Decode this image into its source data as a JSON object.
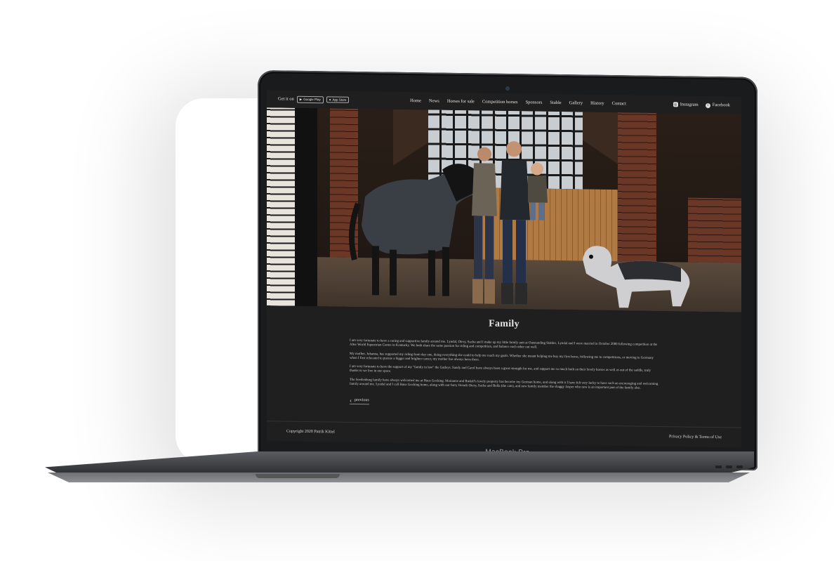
{
  "device": {
    "brand_label": "MacBook Pro"
  },
  "nav": {
    "get_it_on": "Get it on",
    "google_play": "Google Play",
    "app_store": "App Store",
    "links": [
      "Home",
      "News",
      "Horses for sale",
      "Competition horses",
      "Sponsors",
      "Stable",
      "Gallery",
      "History",
      "Contact"
    ],
    "instagram": "Instagram",
    "facebook": "Facebook"
  },
  "page": {
    "title": "Family",
    "paragraphs": [
      "I am very fortunate to have a caring and supportive family around me. Lyndal, Otery, Sacha and I make up my little family unit at Outstanding Stables. Lyndal and I were married in October 2000 following competition at the Alter World Equestrian Centre in Kentucky. We both share the same passion for riding and competition, and balance each other out well.",
      "My mother, Johanna, has supported my riding from day one, doing everything she could to help me reach my goals. Whether she meant helping me buy my first horse, following me to competitions, or moving to Germany when I first relocated to pursue a bigger and brighter career, my mother has always been there.",
      "I am very fortunate to have the support of my \"family in law\" the Gatleys. Sandy and Carol have always been a great strength for me, and support me so much both on their lovely horses as well as out of the saddle, truly thanks to we live in our space.",
      "The Seedenburg family have always welcomed me at Haus Gocking. Marianne and Rudolf's lovely property has become my German home, and along with it I have felt very lucky to have such an encouraging and welcoming family around me. Lyndal and I call Haus Gocking home, along with our furry friends Otery, Sacha and Bella (the cats), and new family member the shaggy Jasper who new is an important part of the family also."
    ],
    "previous_label": "previous"
  },
  "footer": {
    "copyright": "Copyright 2020 Patrik Kittel",
    "legal": "Privacy Policy & Terms of Use"
  }
}
